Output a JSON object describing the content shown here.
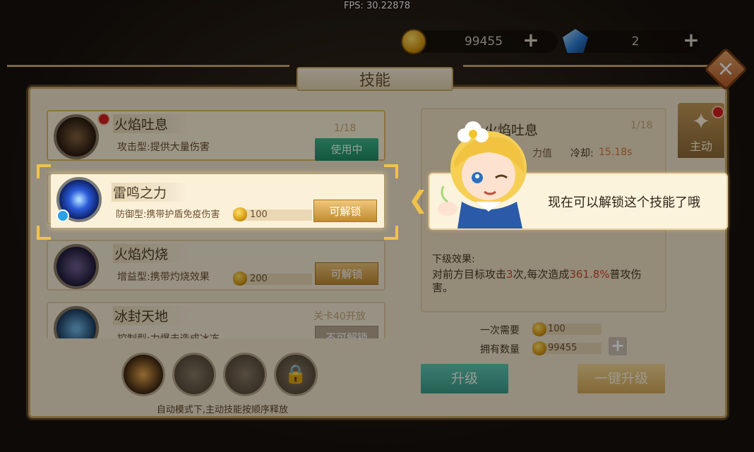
{
  "fps": "FPS: 30.22878",
  "resources": {
    "gold": "99455",
    "gems": "2"
  },
  "title": "技能",
  "skills": [
    {
      "name": "火焰吐息",
      "desc": "攻击型:提供大量伤害",
      "level": "1/18",
      "button": "使用中"
    },
    {
      "name": "雷鸣之力",
      "desc": "防御型:携带护盾免疫伤害",
      "cost": "100",
      "button": "可解锁"
    },
    {
      "name": "火焰灼烧",
      "desc": "增益型:携带灼烧效果",
      "cost": "200",
      "button": "可解锁"
    },
    {
      "name": "冰封天地",
      "desc": "控制型:力爆击造成冰冻",
      "unlock_hint": "关卡40开放",
      "button": "不可解锁"
    }
  ],
  "slot_hint": "自动模式下,主动技能按顺序释放",
  "detail": {
    "name": "火焰吐息",
    "level": "1/18",
    "power_label": "力值",
    "cd_label": "冷却:",
    "cd_value": "15.18s",
    "next_label": "下级效果:",
    "next_text_pre": "对前方目标攻击",
    "next_hits": "3",
    "next_text_mid": "次,每次造成",
    "next_pct": "361.8%",
    "next_text_post": "普攻伤害。",
    "once_label": "一次需要",
    "once_value": "100",
    "own_label": "拥有数量",
    "own_value": "99455",
    "upgrade": "升级",
    "one_key_upgrade": "一键升级"
  },
  "tab_active": "主动",
  "tip": "现在可以解锁这个技能了哦",
  "colors": {
    "panel": "#f1e6cd",
    "accent_gold": "#f1c24a",
    "use_green": "#1f8c66",
    "unlock_gold": "#c18b34",
    "highlight_red": "#d2472c"
  }
}
